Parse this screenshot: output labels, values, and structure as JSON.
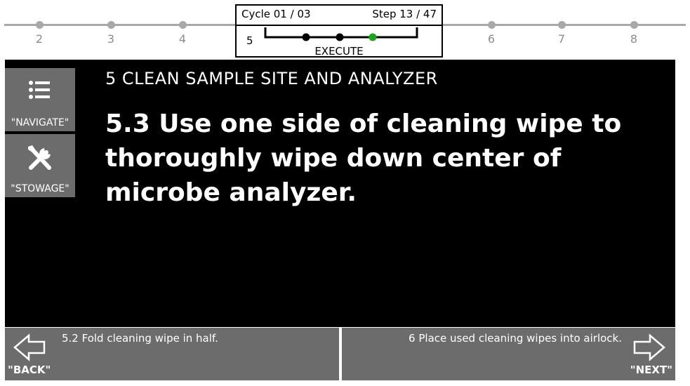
{
  "progress": {
    "left_steps": [
      "2",
      "3",
      "4"
    ],
    "right_steps": [
      "6",
      "7",
      "8"
    ]
  },
  "status": {
    "cycle": "Cycle 01 / 03",
    "step": "Step 13 / 47",
    "current_section": "5",
    "mode": "EXECUTE",
    "substeps_total": 3,
    "substep_current": 3,
    "complete_color": "#000000",
    "current_color": "#1aa81a"
  },
  "side": {
    "navigate_label": "\"NAVIGATE\"",
    "navigate_icon": "list-icon",
    "stowage_label": "\"STOWAGE\"",
    "stowage_icon": "tools-icon"
  },
  "content": {
    "section_title": "5 CLEAN SAMPLE SITE AND ANALYZER",
    "step_text": "5.3 Use one side of cleaning wipe to thoroughly wipe down center of microbe analyzer."
  },
  "nav": {
    "back_text": "5.2 Fold cleaning wipe in half.",
    "back_label": "\"BACK\"",
    "next_text": "6 Place used cleaning wipes into airlock.",
    "next_label": "\"NEXT\""
  },
  "colors": {
    "panel": "#000000",
    "button": "#6c6c6c",
    "track": "#a8a8a8"
  }
}
